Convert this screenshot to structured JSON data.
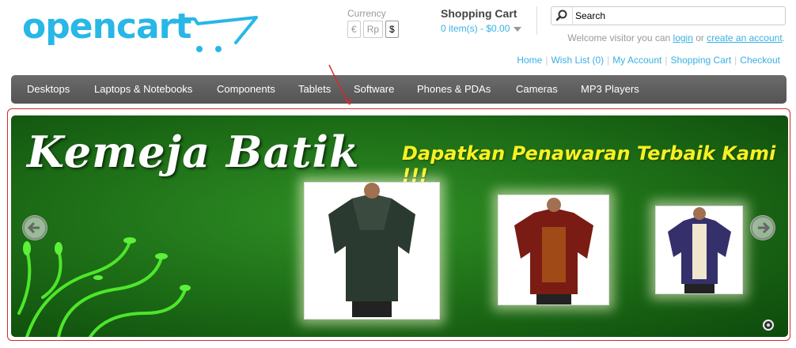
{
  "logo": {
    "text": "opencart"
  },
  "currency": {
    "title": "Currency",
    "options": [
      "€",
      "Rp",
      "$"
    ],
    "selected": "$"
  },
  "cart": {
    "title": "Shopping Cart",
    "total": "0 item(s) - $0.00"
  },
  "search": {
    "placeholder": "Search"
  },
  "welcome": {
    "prefix": "Welcome visitor you can ",
    "login": "login",
    "middle": " or ",
    "create": "create an account",
    "suffix": "."
  },
  "links": [
    "Home",
    "Wish List (0)",
    "My Account",
    "Shopping Cart",
    "Checkout"
  ],
  "menu": [
    "Desktops",
    "Laptops & Notebooks",
    "Components",
    "Tablets",
    "Software",
    "Phones & PDAs",
    "Cameras",
    "MP3 Players"
  ],
  "banner": {
    "title": "Kemeja Batik",
    "tagline": "Dapatkan Penawaran Terbaik Kami !!!",
    "background_color": "#1f6e18",
    "title_color": "#ffffff",
    "tagline_color": "#f5f224",
    "slide_count": 1
  },
  "colors": {
    "accent": "#38b0e3",
    "logo": "#28b7e7",
    "menu": "#5f5f5f",
    "annotation": "#d42a2a"
  }
}
